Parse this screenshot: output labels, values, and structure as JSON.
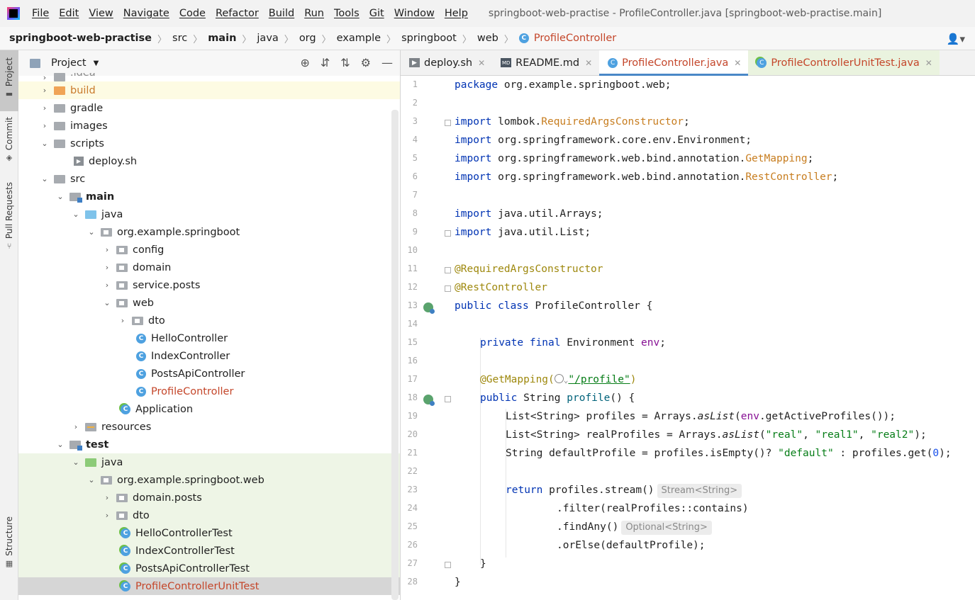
{
  "menubar": {
    "items": [
      "File",
      "Edit",
      "View",
      "Navigate",
      "Code",
      "Refactor",
      "Build",
      "Run",
      "Tools",
      "Git",
      "Window",
      "Help"
    ],
    "window_title": "springboot-web-practise - ProfileController.java [springboot-web-practise.main]"
  },
  "breadcrumb": [
    "springboot-web-practise",
    "src",
    "main",
    "java",
    "org",
    "example",
    "springboot",
    "web",
    "ProfileController"
  ],
  "toolstrip": {
    "project": "Project",
    "commit": "Commit",
    "pull_requests": "Pull Requests",
    "structure": "Structure"
  },
  "project_panel": {
    "title": "Project",
    "tree": [
      {
        "label": ".idea"
      },
      {
        "label": "build"
      },
      {
        "label": "gradle"
      },
      {
        "label": "images"
      },
      {
        "label": "scripts"
      },
      {
        "label": "deploy.sh"
      },
      {
        "label": "src"
      },
      {
        "label": "main"
      },
      {
        "label": "java"
      },
      {
        "label": "org.example.springboot"
      },
      {
        "label": "config"
      },
      {
        "label": "domain"
      },
      {
        "label": "service.posts"
      },
      {
        "label": "web"
      },
      {
        "label": "dto"
      },
      {
        "label": "HelloController"
      },
      {
        "label": "IndexController"
      },
      {
        "label": "PostsApiController"
      },
      {
        "label": "ProfileController"
      },
      {
        "label": "Application"
      },
      {
        "label": "resources"
      },
      {
        "label": "test"
      },
      {
        "label": "java"
      },
      {
        "label": "org.example.springboot.web"
      },
      {
        "label": "domain.posts"
      },
      {
        "label": "dto"
      },
      {
        "label": "HelloControllerTest"
      },
      {
        "label": "IndexControllerTest"
      },
      {
        "label": "PostsApiControllerTest"
      },
      {
        "label": "ProfileControllerUnitTest"
      }
    ]
  },
  "editor": {
    "tabs": [
      {
        "label": "deploy.sh"
      },
      {
        "label": "README.md"
      },
      {
        "label": "ProfileController.java"
      },
      {
        "label": "ProfileControllerUnitTest.java"
      }
    ],
    "line_numbers": [
      "1",
      "2",
      "3",
      "4",
      "5",
      "6",
      "7",
      "8",
      "9",
      "10",
      "11",
      "12",
      "13",
      "14",
      "15",
      "16",
      "17",
      "18",
      "19",
      "20",
      "21",
      "22",
      "23",
      "24",
      "25",
      "26",
      "27",
      "28"
    ],
    "code": {
      "l1_kw": "package",
      "l1_rest": " org.example.springboot.web;",
      "l3_kw": "import",
      "l3_a": " lombok.",
      "l3_b": "RequiredArgsConstructor",
      "l3_c": ";",
      "l4_kw": "import",
      "l4_a": " org.springframework.core.env.Environment;",
      "l5_kw": "import",
      "l5_a": " org.springframework.web.bind.annotation.",
      "l5_b": "GetMapping",
      "l5_c": ";",
      "l6_kw": "import",
      "l6_a": " org.springframework.web.bind.annotation.",
      "l6_b": "RestController",
      "l6_c": ";",
      "l8_kw": "import",
      "l8_a": " java.util.Arrays;",
      "l9_kw": "import",
      "l9_a": " java.util.List;",
      "l11": "@RequiredArgsConstructor",
      "l12": "@RestController",
      "l13_kw": "public class",
      "l13_a": " ProfileController {",
      "l15_kw": "private final",
      "l15_a": " Environment ",
      "l15_b": "env",
      "l15_c": ";",
      "l17_a": "@GetMapping(",
      "l17_b": "\"/profile\"",
      "l17_c": ")",
      "l18_kw": "public",
      "l18_a": " String ",
      "l18_b": "profile",
      "l18_c": "() {",
      "l19_a": "List<String> profiles = Arrays.",
      "l19_b": "asList",
      "l19_c": "(",
      "l19_d": "env",
      "l19_e": ".getActiveProfiles());",
      "l20_a": "List<String> realProfiles = Arrays.",
      "l20_b": "asList",
      "l20_c": "(",
      "l20_d": "\"real\"",
      "l20_e": ", ",
      "l20_f": "\"real1\"",
      "l20_g": ", ",
      "l20_h": "\"real2\"",
      "l20_i": ");",
      "l21_a": "String defaultProfile = profiles.isEmpty()? ",
      "l21_b": "\"default\"",
      "l21_c": " : profiles.get(",
      "l21_d": "0",
      "l21_e": ");",
      "l23_kw": "return",
      "l23_a": " profiles.stream()",
      "l23_hint": "Stream<String>",
      "l24": ".filter(realProfiles::contains)",
      "l25_a": ".findAny()",
      "l25_hint": "Optional<String>",
      "l26": ".orElse(defaultProfile);",
      "l27": "}",
      "l28": "}"
    }
  }
}
